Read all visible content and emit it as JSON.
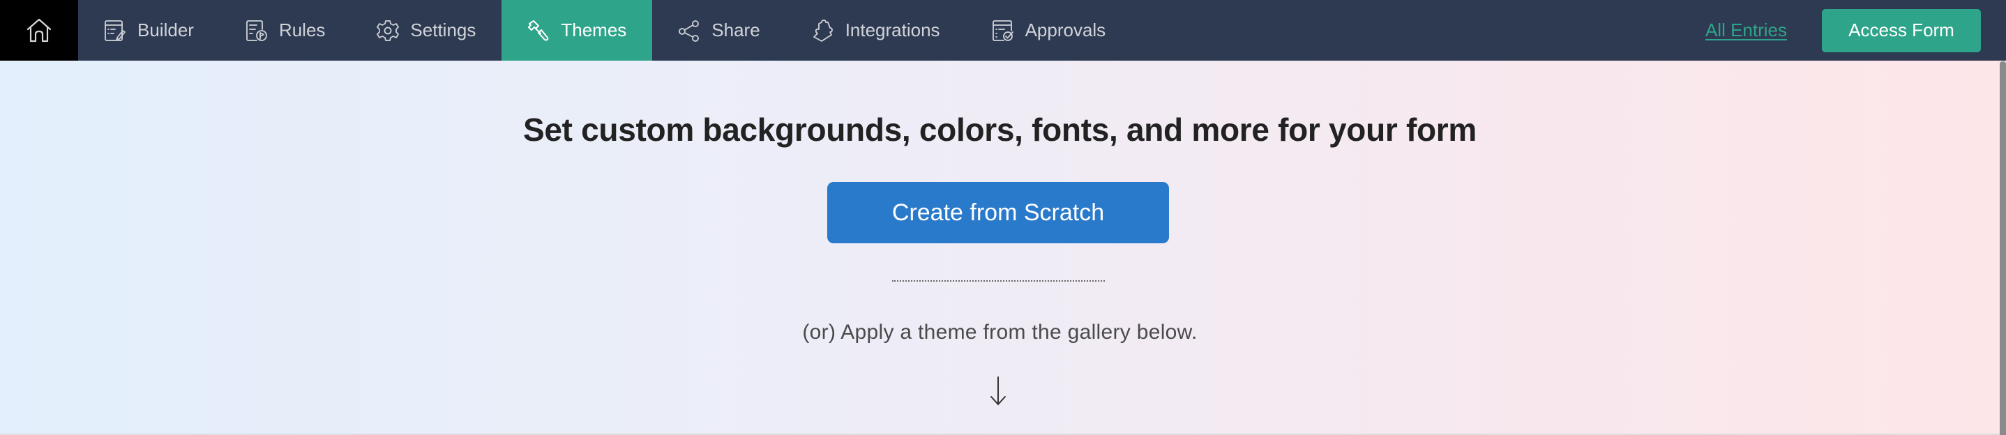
{
  "nav": {
    "home_icon": "home-icon",
    "tabs": [
      {
        "label": "Builder",
        "icon": "form-builder-icon",
        "active": false
      },
      {
        "label": "Rules",
        "icon": "rules-icon",
        "active": false
      },
      {
        "label": "Settings",
        "icon": "gear-icon",
        "active": false
      },
      {
        "label": "Themes",
        "icon": "paint-roller-icon",
        "active": true
      },
      {
        "label": "Share",
        "icon": "share-icon",
        "active": false
      },
      {
        "label": "Integrations",
        "icon": "puzzle-icon",
        "active": false
      },
      {
        "label": "Approvals",
        "icon": "approvals-icon",
        "active": false
      }
    ],
    "all_entries_label": "All Entries",
    "access_form_label": "Access Form"
  },
  "main": {
    "heading": "Set custom backgrounds, colors, fonts, and more for your form",
    "create_button_label": "Create from Scratch",
    "subtitle": "(or) Apply a theme from the gallery below.",
    "arrow_icon": "arrow-down-icon"
  },
  "colors": {
    "nav_bg": "#2e3a52",
    "accent": "#2ea58a",
    "primary_button": "#2a7acb",
    "home_bg": "#000000"
  }
}
